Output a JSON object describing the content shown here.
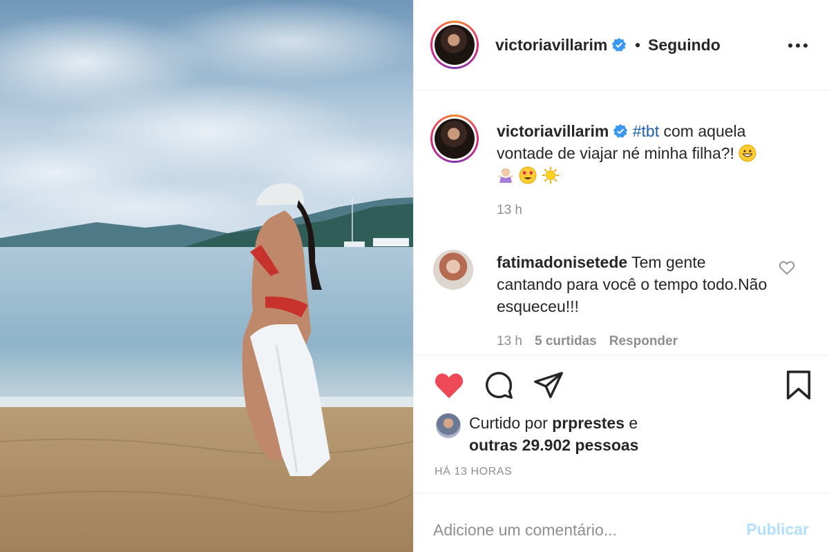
{
  "post": {
    "author": "victoriavillarim",
    "follow_separator": "•",
    "follow_status": "Seguindo",
    "more_icon": "more-horizontal-icon"
  },
  "caption": {
    "author": "victoriavillarim",
    "hashtag": "#tbt",
    "text": " com aquela vontade de viajar né minha filha?! ",
    "emojis": [
      "grinning-face-emoji",
      "woman-shrugging-emoji",
      "heart-eyes-emoji",
      "sun-emoji"
    ],
    "time": "13 h"
  },
  "comment": {
    "author": "fatimadonisetede",
    "text": " Tem gente cantando para você o tempo todo.Não esqueceu!!!",
    "time": "13 h",
    "likes": "5 curtidas",
    "reply": "Responder"
  },
  "actions": {
    "like_icon": "heart-filled-icon",
    "comment_icon": "comment-icon",
    "share_icon": "send-icon",
    "save_icon": "bookmark-icon",
    "liked_color": "#ed4956"
  },
  "likes": {
    "prefix": "Curtido por ",
    "user": "prprestes",
    "middle": " e",
    "others": "outras 29.902 pessoas"
  },
  "timestamp": "HÁ 13 HORAS",
  "add_comment": {
    "placeholder": "Adicione um comentário...",
    "publish": "Publicar",
    "publish_color": "#b2dffc"
  }
}
